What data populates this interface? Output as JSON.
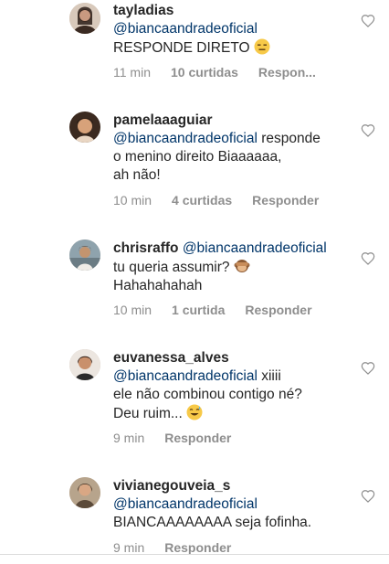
{
  "comments": [
    {
      "username": "tayladias",
      "mention": "@biancaandradeoficial",
      "line1_rest": "",
      "lines": [
        "RESPONDE DIRETO"
      ],
      "emoji": "expressionless-face",
      "time": "11 min",
      "likes": "10 curtidas",
      "reply": "Respon..."
    },
    {
      "username": "pamelaaaguiar",
      "mention": "@biancaandradeoficial",
      "line1_rest": "responde",
      "lines": [
        "o menino direito Biaaaaaa,",
        "ah não!"
      ],
      "emoji": "",
      "time": "10 min",
      "likes": "4 curtidas",
      "reply": "Responder"
    },
    {
      "username": "chrisraffo",
      "mention": "@biancaandradeoficial",
      "line1_rest": "",
      "lines": [
        "tu queria assumir?",
        "Hahahahahah"
      ],
      "emoji": "see-no-evil-monkey",
      "time": "10 min",
      "likes": "1 curtida",
      "reply": "Responder"
    },
    {
      "username": "euvanessa_alves",
      "mention": "@biancaandradeoficial",
      "line1_rest": "xiiii",
      "lines": [
        "ele não combinou contigo né?",
        "Deu ruim..."
      ],
      "emoji": "grinning-sweat-face",
      "time": "9 min",
      "likes": "",
      "reply": "Responder"
    },
    {
      "username": "vivianegouveia_s",
      "mention": "@biancaandradeoficial",
      "line1_rest": "",
      "lines": [
        "BIANCAAAAAAAA seja fofinha."
      ],
      "emoji": "",
      "time": "9 min",
      "likes": "",
      "reply": "Responder"
    }
  ],
  "colors": {
    "text": "#262626",
    "mention": "#003569",
    "meta": "#8e8e8e",
    "divider": "#dbdbdb"
  },
  "icons": {
    "like": "heart-outline-icon"
  }
}
